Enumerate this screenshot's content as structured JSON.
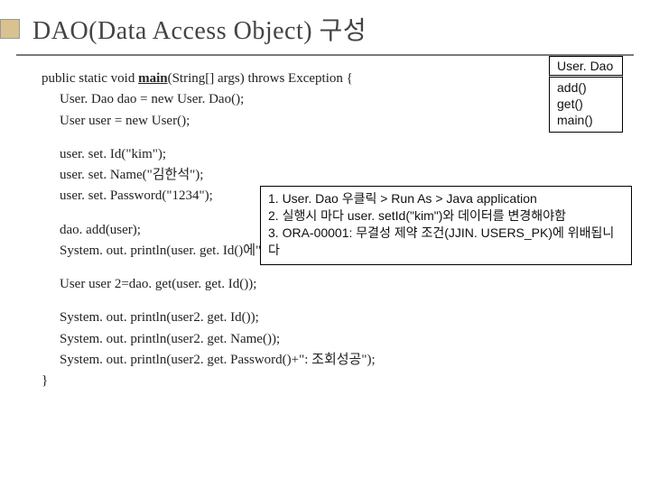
{
  "title": "DAO(Data Access Object)  구성",
  "code": {
    "line1a": "public static void ",
    "line1b": "main",
    "line1c": "(String[] args) throws Exception {",
    "line2": "User. Dao dao = new User. Dao();",
    "line3": "User user = new User();",
    "line4": "user. set. Id(\"kim\");",
    "line5": "user. set. Name(\"김한석\");",
    "line6": "user. set. Password(\"1234\");",
    "line7": "dao. add(user);",
    "line8": "System. out. println(user. get. Id()에\"위래록성공\");",
    "line9": "User user 2=dao. get(user. get. Id());",
    "line10": "System. out. println(user2. get. Id());",
    "line11": "System. out. println(user2. get. Name());",
    "line12": "System. out. println(user2. get. Password()+\": 조회성공\");",
    "line13": "}"
  },
  "uml": {
    "class_name": "User. Dao",
    "m1": "add()",
    "m2": "get()",
    "m3": "main()"
  },
  "callout": {
    "l1": "1. User. Dao 우클릭 > Run As > Java application",
    "l2": "2. 실행시 마다 user. setId(\"kim\")와 데이터를  변경해야함",
    "l3": "3. ORA-00001: 무결성 제약 조건(JJIN. USERS_PK)에 위배됩니다"
  }
}
